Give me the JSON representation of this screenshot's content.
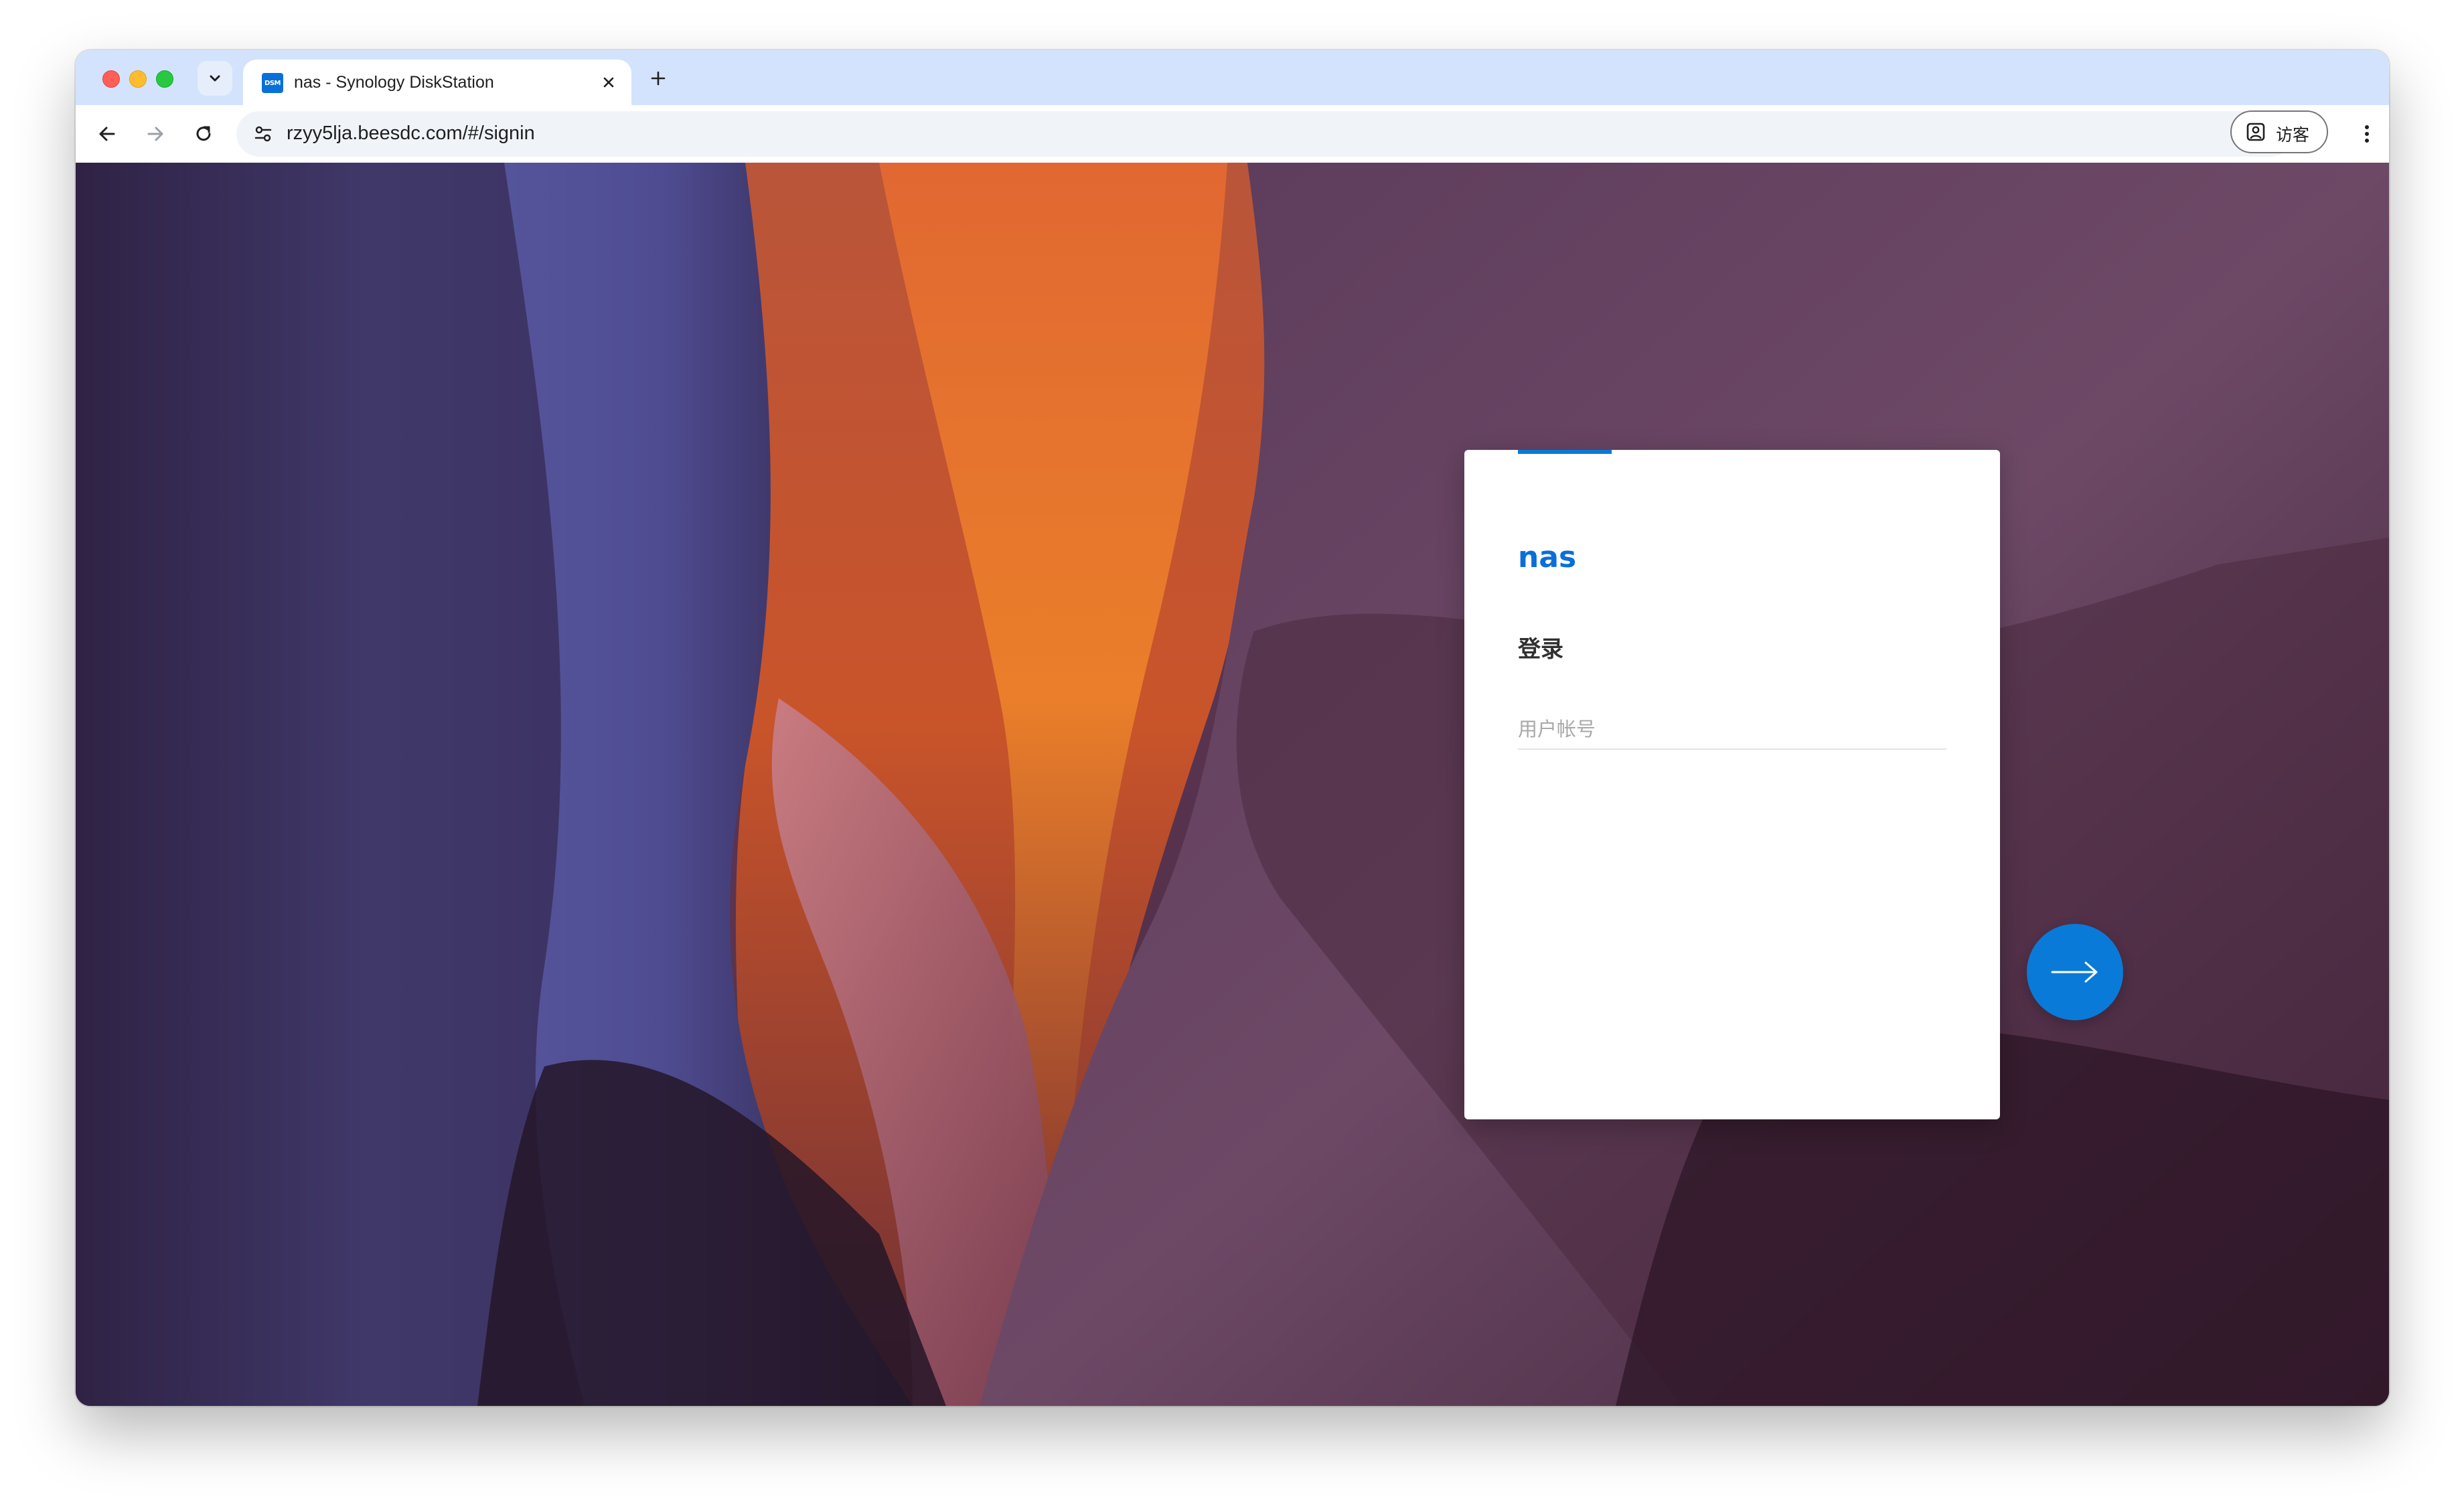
{
  "browser": {
    "tab": {
      "title": "nas - Synology DiskStation",
      "favicon_text": "DSM",
      "favicon_icon": "synology-dsm-icon"
    },
    "address_bar": {
      "url": "rzyy5lja.beesdc.com/#/signin"
    },
    "profile": {
      "label": "访客",
      "icon": "guest-profile-icon"
    }
  },
  "login": {
    "host_name": "nas",
    "heading": "登录",
    "username_placeholder": "用户帐号",
    "username_value": "",
    "submit_icon": "arrow-right-icon"
  },
  "colors": {
    "accent": "#0a7ad9",
    "tabstrip": "#d3e3fd"
  }
}
